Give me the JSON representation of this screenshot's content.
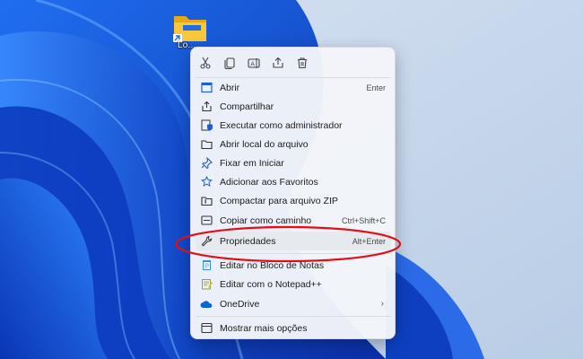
{
  "desktop": {
    "icon_label": "Lo..."
  },
  "quick_actions": [
    {
      "icon": "cut-icon"
    },
    {
      "icon": "copy-icon"
    },
    {
      "icon": "rename-icon"
    },
    {
      "icon": "share-icon"
    },
    {
      "icon": "delete-icon"
    }
  ],
  "menu": {
    "items": [
      {
        "label": "Abrir",
        "shortcut": "Enter",
        "icon": "open-icon"
      },
      {
        "label": "Compartilhar",
        "shortcut": "",
        "icon": "share-icon"
      },
      {
        "label": "Executar como administrador",
        "shortcut": "",
        "icon": "shield-icon"
      },
      {
        "label": "Abrir local do arquivo",
        "shortcut": "",
        "icon": "folder-icon"
      },
      {
        "label": "Fixar em Iniciar",
        "shortcut": "",
        "icon": "pin-icon"
      },
      {
        "label": "Adicionar aos Favoritos",
        "shortcut": "",
        "icon": "star-icon"
      },
      {
        "label": "Compactar para arquivo ZIP",
        "shortcut": "",
        "icon": "zip-icon"
      },
      {
        "label": "Copiar como caminho",
        "shortcut": "Ctrl+Shift+C",
        "icon": "copy-path-icon"
      },
      {
        "label": "Propriedades",
        "shortcut": "Alt+Enter",
        "icon": "wrench-icon"
      },
      {
        "label": "Editar no Bloco de Notas",
        "shortcut": "",
        "icon": "notepad-icon"
      },
      {
        "label": "Editar com o Notepad++",
        "shortcut": "",
        "icon": "notepadpp-icon"
      },
      {
        "label": "OneDrive",
        "shortcut": "",
        "icon": "cloud-icon",
        "submenu": "›"
      },
      {
        "label": "Mostrar mais opções",
        "shortcut": "",
        "icon": "more-options-icon"
      }
    ]
  },
  "colors": {
    "highlight_ellipse": "#e0101a",
    "accent": "#0a5fd0"
  }
}
